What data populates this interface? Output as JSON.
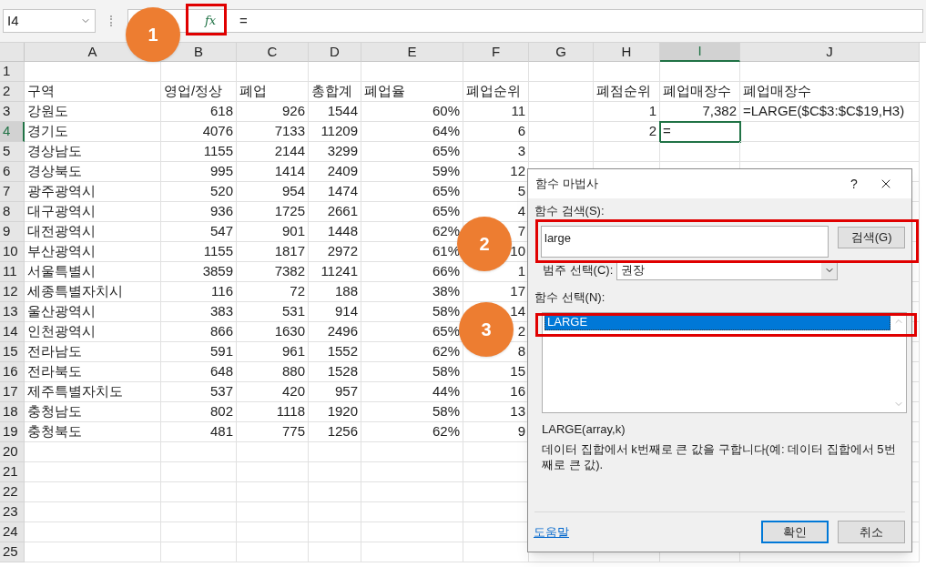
{
  "formula_bar": {
    "name_box": "I4",
    "fx": "fx",
    "formula": "="
  },
  "columns": [
    {
      "label": "A",
      "selected": false
    },
    {
      "label": "B",
      "selected": false
    },
    {
      "label": "C",
      "selected": false
    },
    {
      "label": "D",
      "selected": false
    },
    {
      "label": "E",
      "selected": false
    },
    {
      "label": "F",
      "selected": false
    },
    {
      "label": "G",
      "selected": false
    },
    {
      "label": "H",
      "selected": false
    },
    {
      "label": "I",
      "selected": true
    },
    {
      "label": "J",
      "selected": false
    }
  ],
  "rows": [
    {
      "number": "1",
      "selected": false,
      "cells": []
    },
    {
      "number": "2",
      "selected": false,
      "cells": [
        "구역",
        "영업/정상",
        "폐업",
        "총합계",
        "폐업율",
        "폐업순위",
        "",
        "폐점순위",
        "폐업매장수",
        "폐업매장수"
      ]
    },
    {
      "number": "3",
      "selected": false,
      "cells": [
        "강원도",
        "618",
        "926",
        "1544",
        "60%",
        "11",
        "",
        "1",
        "7,382",
        "=LARGE($C$3:$C$19,H3)"
      ]
    },
    {
      "number": "4",
      "selected": true,
      "cells": [
        "경기도",
        "4076",
        "7133",
        "11209",
        "64%",
        "6",
        "",
        "2",
        "="
      ]
    },
    {
      "number": "5",
      "selected": false,
      "cells": [
        "경상남도",
        "1155",
        "2144",
        "3299",
        "65%",
        "3"
      ]
    },
    {
      "number": "6",
      "selected": false,
      "cells": [
        "경상북도",
        "995",
        "1414",
        "2409",
        "59%",
        "12"
      ]
    },
    {
      "number": "7",
      "selected": false,
      "cells": [
        "광주광역시",
        "520",
        "954",
        "1474",
        "65%",
        "5"
      ]
    },
    {
      "number": "8",
      "selected": false,
      "cells": [
        "대구광역시",
        "936",
        "1725",
        "2661",
        "65%",
        "4"
      ]
    },
    {
      "number": "9",
      "selected": false,
      "cells": [
        "대전광역시",
        "547",
        "901",
        "1448",
        "62%",
        "7"
      ]
    },
    {
      "number": "10",
      "selected": false,
      "cells": [
        "부산광역시",
        "1155",
        "1817",
        "2972",
        "61%",
        "10"
      ]
    },
    {
      "number": "11",
      "selected": false,
      "cells": [
        "서울특별시",
        "3859",
        "7382",
        "11241",
        "66%",
        "1"
      ]
    },
    {
      "number": "12",
      "selected": false,
      "cells": [
        "세종특별자치시",
        "116",
        "72",
        "188",
        "38%",
        "17"
      ]
    },
    {
      "number": "13",
      "selected": false,
      "cells": [
        "울산광역시",
        "383",
        "531",
        "914",
        "58%",
        "14"
      ]
    },
    {
      "number": "14",
      "selected": false,
      "cells": [
        "인천광역시",
        "866",
        "1630",
        "2496",
        "65%",
        "2"
      ]
    },
    {
      "number": "15",
      "selected": false,
      "cells": [
        "전라남도",
        "591",
        "961",
        "1552",
        "62%",
        "8"
      ]
    },
    {
      "number": "16",
      "selected": false,
      "cells": [
        "전라북도",
        "648",
        "880",
        "1528",
        "58%",
        "15"
      ]
    },
    {
      "number": "17",
      "selected": false,
      "cells": [
        "제주특별자치도",
        "537",
        "420",
        "957",
        "44%",
        "16"
      ]
    },
    {
      "number": "18",
      "selected": false,
      "cells": [
        "충청남도",
        "802",
        "1118",
        "1920",
        "58%",
        "13"
      ]
    },
    {
      "number": "19",
      "selected": false,
      "cells": [
        "충청북도",
        "481",
        "775",
        "1256",
        "62%",
        "9"
      ]
    },
    {
      "number": "20",
      "selected": false,
      "cells": []
    },
    {
      "number": "21",
      "selected": false,
      "cells": []
    },
    {
      "number": "22",
      "selected": false,
      "cells": []
    },
    {
      "number": "23",
      "selected": false,
      "cells": []
    },
    {
      "number": "24",
      "selected": false,
      "cells": []
    },
    {
      "number": "25",
      "selected": false,
      "cells": []
    }
  ],
  "dialog": {
    "title": "함수 마법사",
    "help": "?",
    "search_label": "함수 검색(S):",
    "search_value": "large",
    "search_button": "검색(G)",
    "category_label": "범주 선택(C):",
    "category_value": "권장",
    "function_label": "함수 선택(N):",
    "functions": [
      {
        "name": "LARGE",
        "selected": true
      }
    ],
    "syntax": "LARGE(array,k)",
    "description": "데이터 집합에서 k번째로 큰 값을 구합니다(예: 데이터 집합에서 5번째로 큰 값).",
    "help_link": "도움말",
    "ok_button": "확인",
    "cancel_button": "취소"
  },
  "callouts": [
    {
      "label": "1"
    },
    {
      "label": "2"
    },
    {
      "label": "3"
    }
  ]
}
